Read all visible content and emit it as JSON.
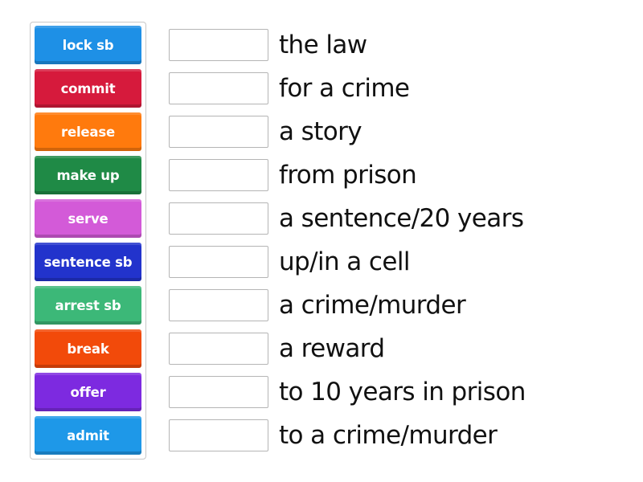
{
  "tiles": [
    {
      "label": "lock sb",
      "color": "#1e90e6"
    },
    {
      "label": "commit",
      "color": "#d61a3c"
    },
    {
      "label": "release",
      "color": "#ff7a0d"
    },
    {
      "label": "make up",
      "color": "#1f8a46"
    },
    {
      "label": "serve",
      "color": "#d35ad8"
    },
    {
      "label": "sentence sb",
      "color": "#2233cc"
    },
    {
      "label": "arrest sb",
      "color": "#3cb878"
    },
    {
      "label": "break",
      "color": "#f24a0a"
    },
    {
      "label": "offer",
      "color": "#7d2ae0"
    },
    {
      "label": "admit",
      "color": "#1e98e8"
    }
  ],
  "clues": [
    {
      "text": "the law",
      "answer": ""
    },
    {
      "text": "for a crime",
      "answer": ""
    },
    {
      "text": "a story",
      "answer": ""
    },
    {
      "text": "from prison",
      "answer": ""
    },
    {
      "text": "a sentence/20 years",
      "answer": ""
    },
    {
      "text": "up/in a cell",
      "answer": ""
    },
    {
      "text": "a crime/murder",
      "answer": ""
    },
    {
      "text": "a reward",
      "answer": ""
    },
    {
      "text": "to 10 years in prison",
      "answer": ""
    },
    {
      "text": "to a crime/murder",
      "answer": ""
    }
  ]
}
